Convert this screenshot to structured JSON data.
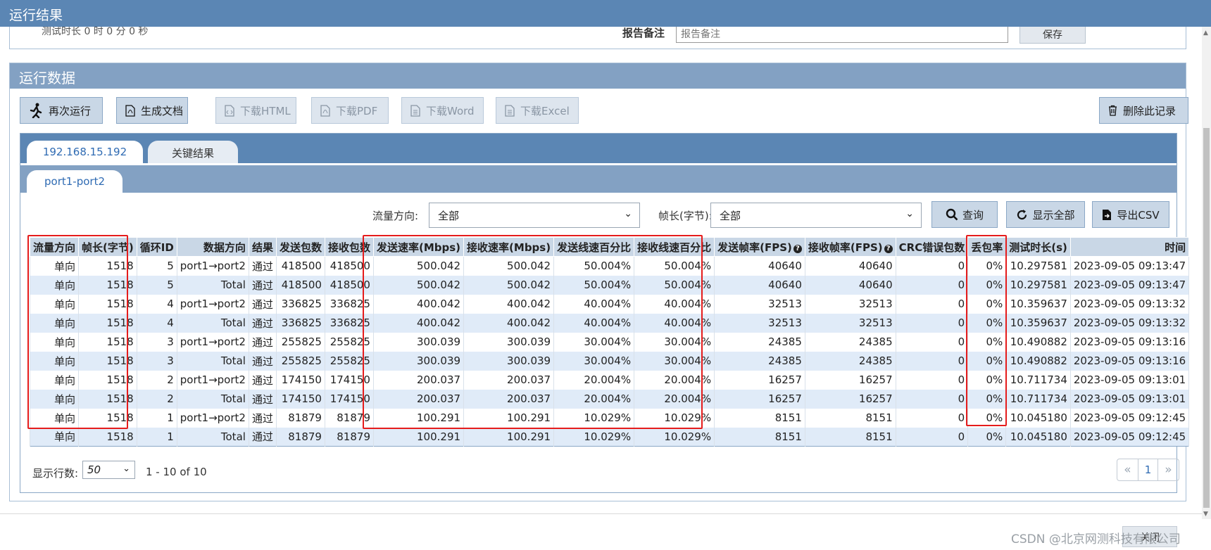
{
  "window": {
    "title": "运行结果"
  },
  "top_panel": {
    "truncated_text": "测试时长 0 时 0 分 0 秒",
    "note_label": "报告备注",
    "note_placeholder": "报告备注",
    "save_label": "保存"
  },
  "run_panel": {
    "title": "运行数据",
    "buttons": {
      "rerun": "再次运行",
      "generate_doc": "生成文档",
      "download_html": "下载HTML",
      "download_pdf": "下载PDF",
      "download_word": "下载Word",
      "download_excel": "下载Excel",
      "delete_record": "删除此记录"
    }
  },
  "tabs": {
    "level1": [
      "192.168.15.192",
      "关键结果"
    ],
    "level2": [
      "port1-port2"
    ]
  },
  "filters": {
    "direction_label": "流量方向:",
    "direction_value": "全部",
    "framelen_label": "帧长(字节):",
    "framelen_value": "全部",
    "query_label": "查询",
    "show_all_label": "显示全部",
    "export_label": "导出CSV"
  },
  "table": {
    "headers": [
      "流量方向",
      "帧长(字节)",
      "循环ID",
      "数据方向",
      "结果",
      "发送包数",
      "接收包数",
      "发送速率(Mbps)",
      "接收速率(Mbps)",
      "发送线速百分比",
      "接收线速百分比",
      "发送帧率(FPS)",
      "接收帧率(FPS)",
      "CRC错误包数",
      "丢包率",
      "测试时长(s)",
      "时间"
    ],
    "rows": [
      [
        "单向",
        "1518",
        "5",
        "port1→port2",
        "通过",
        "418500",
        "418500",
        "500.042",
        "500.042",
        "50.004%",
        "50.004%",
        "40640",
        "40640",
        "0",
        "0%",
        "10.297581",
        "2023-09-05 09:13:47"
      ],
      [
        "单向",
        "1518",
        "5",
        "Total",
        "通过",
        "418500",
        "418500",
        "500.042",
        "500.042",
        "50.004%",
        "50.004%",
        "40640",
        "40640",
        "0",
        "0%",
        "10.297581",
        "2023-09-05 09:13:47"
      ],
      [
        "单向",
        "1518",
        "4",
        "port1→port2",
        "通过",
        "336825",
        "336825",
        "400.042",
        "400.042",
        "40.004%",
        "40.004%",
        "32513",
        "32513",
        "0",
        "0%",
        "10.359637",
        "2023-09-05 09:13:32"
      ],
      [
        "单向",
        "1518",
        "4",
        "Total",
        "通过",
        "336825",
        "336825",
        "400.042",
        "400.042",
        "40.004%",
        "40.004%",
        "32513",
        "32513",
        "0",
        "0%",
        "10.359637",
        "2023-09-05 09:13:32"
      ],
      [
        "单向",
        "1518",
        "3",
        "port1→port2",
        "通过",
        "255825",
        "255825",
        "300.039",
        "300.039",
        "30.004%",
        "30.004%",
        "24385",
        "24385",
        "0",
        "0%",
        "10.490882",
        "2023-09-05 09:13:16"
      ],
      [
        "单向",
        "1518",
        "3",
        "Total",
        "通过",
        "255825",
        "255825",
        "300.039",
        "300.039",
        "30.004%",
        "30.004%",
        "24385",
        "24385",
        "0",
        "0%",
        "10.490882",
        "2023-09-05 09:13:16"
      ],
      [
        "单向",
        "1518",
        "2",
        "port1→port2",
        "通过",
        "174150",
        "174150",
        "200.037",
        "200.037",
        "20.004%",
        "20.004%",
        "16257",
        "16257",
        "0",
        "0%",
        "10.711734",
        "2023-09-05 09:13:01"
      ],
      [
        "单向",
        "1518",
        "2",
        "Total",
        "通过",
        "174150",
        "174150",
        "200.037",
        "200.037",
        "20.004%",
        "20.004%",
        "16257",
        "16257",
        "0",
        "0%",
        "10.711734",
        "2023-09-05 09:13:01"
      ],
      [
        "单向",
        "1518",
        "1",
        "port1→port2",
        "通过",
        "81879",
        "81879",
        "100.291",
        "100.291",
        "10.029%",
        "10.029%",
        "8151",
        "8151",
        "0",
        "0%",
        "10.045180",
        "2023-09-05 09:12:45"
      ],
      [
        "单向",
        "1518",
        "1",
        "Total",
        "通过",
        "81879",
        "81879",
        "100.291",
        "100.291",
        "10.029%",
        "10.029%",
        "8151",
        "8151",
        "0",
        "0%",
        "10.045180",
        "2023-09-05 09:12:45"
      ]
    ]
  },
  "footer": {
    "rows_label": "显示行数:",
    "rows_value": "50",
    "range_text": "1 - 10 of 10",
    "prev_glyph": "«",
    "current_page": "1",
    "next_glyph": "»"
  },
  "bottom": {
    "close_label": "关闭",
    "watermark": "CSDN @北京网测科技有限公司"
  },
  "colors": {
    "titlebar": "#5b86b4",
    "panel_header": "#83a1c3",
    "button_bg": "#c9d7e6",
    "row_alt": "#e0ebf8",
    "highlight_box": "#e51c1c"
  },
  "icons": {
    "rerun": "running-man-icon",
    "doc": "pdf-file-icon",
    "html": "code-file-icon",
    "pdf": "pdf-file-icon",
    "word": "word-file-icon",
    "excel": "excel-file-icon",
    "delete": "trash-icon",
    "query": "search-icon",
    "show_all": "refresh-icon",
    "export": "export-file-icon",
    "help": "question-circle-icon"
  }
}
